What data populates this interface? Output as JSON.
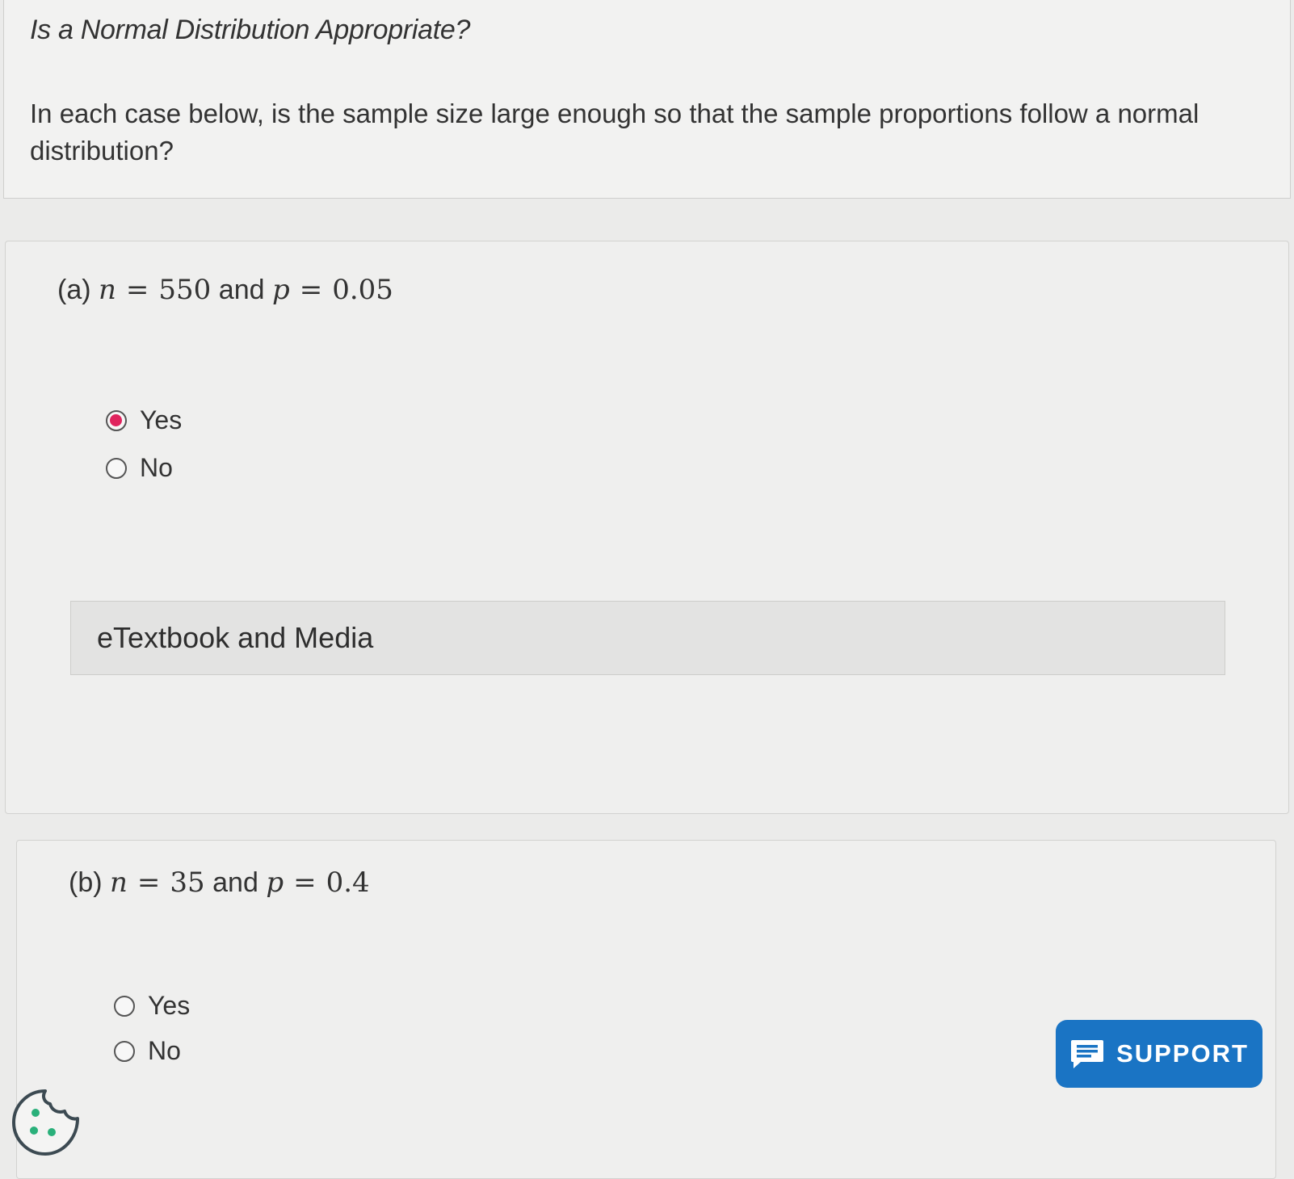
{
  "intro": {
    "title": "Is a Normal Distribution Appropriate?",
    "text": "In each case below, is the sample size large enough so that the sample proportions follow a normal distribution?"
  },
  "part_a": {
    "label": "(a)",
    "n_var": "n",
    "equals": "=",
    "n_value": "550",
    "and": "and",
    "p_var": "p",
    "p_value": "0.05",
    "options": [
      {
        "label": "Yes",
        "selected": true
      },
      {
        "label": "No",
        "selected": false
      }
    ],
    "media_label": "eTextbook and Media"
  },
  "part_b": {
    "label": "(b)",
    "n_var": "n",
    "equals": "=",
    "n_value": "35",
    "and": "and",
    "p_var": "p",
    "p_value": "0.4",
    "options": [
      {
        "label": "Yes",
        "selected": false
      },
      {
        "label": "No",
        "selected": false
      }
    ]
  },
  "support": {
    "label": "SUPPORT",
    "icon": "chat-icon"
  },
  "cookie": {
    "icon": "cookie-icon"
  },
  "colors": {
    "selected_radio": "#e0245e",
    "support_button": "#1a74c4",
    "cookie_dots": "#2ab07a"
  }
}
